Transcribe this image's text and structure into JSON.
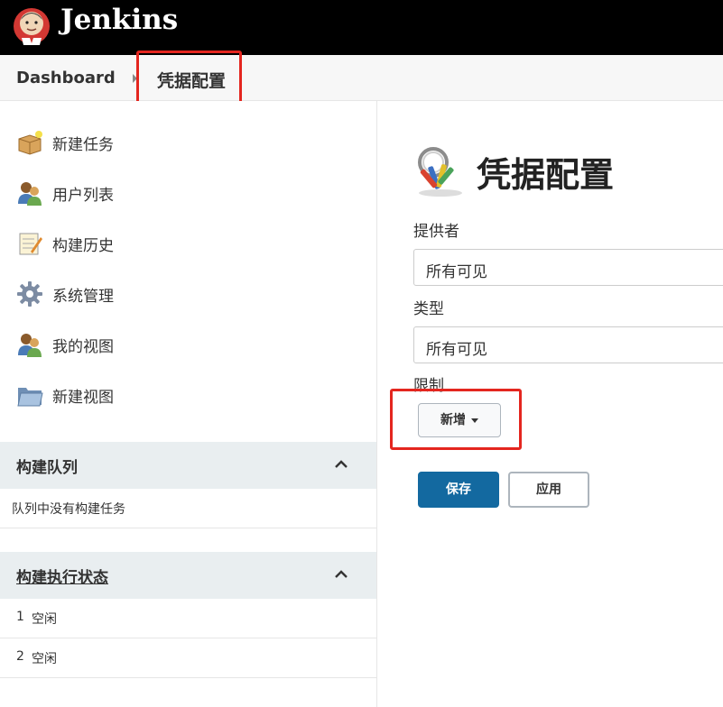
{
  "app": {
    "name": "Jenkins"
  },
  "breadcrumb": {
    "home": "Dashboard",
    "current": "凭据配置"
  },
  "sidebar": {
    "tasks": [
      {
        "label": "新建任务",
        "icon": "new-package-icon"
      },
      {
        "label": "用户列表",
        "icon": "users-icon"
      },
      {
        "label": "构建历史",
        "icon": "notepad-icon"
      },
      {
        "label": "系统管理",
        "icon": "gear-icon"
      },
      {
        "label": "我的视图",
        "icon": "users-icon"
      },
      {
        "label": "新建视图",
        "icon": "folder-icon"
      }
    ],
    "build_queue": {
      "title": "构建队列",
      "empty_text": "队列中没有构建任务"
    },
    "executors": {
      "title": "构建执行状态",
      "rows": [
        {
          "num": "1",
          "state": "空闲"
        },
        {
          "num": "2",
          "state": "空闲"
        }
      ]
    }
  },
  "main": {
    "title": "凭据配置",
    "fields": {
      "provider": {
        "label": "提供者",
        "value": "所有可见"
      },
      "type": {
        "label": "类型",
        "value": "所有可见"
      },
      "restriction": {
        "label": "限制",
        "add_button": "新增"
      }
    },
    "buttons": {
      "save": "保存",
      "apply": "应用"
    }
  },
  "colors": {
    "primary": "#1369a0",
    "highlight": "#e4261f",
    "header_bg": "#000000",
    "pane_bg": "#e9eef0"
  }
}
